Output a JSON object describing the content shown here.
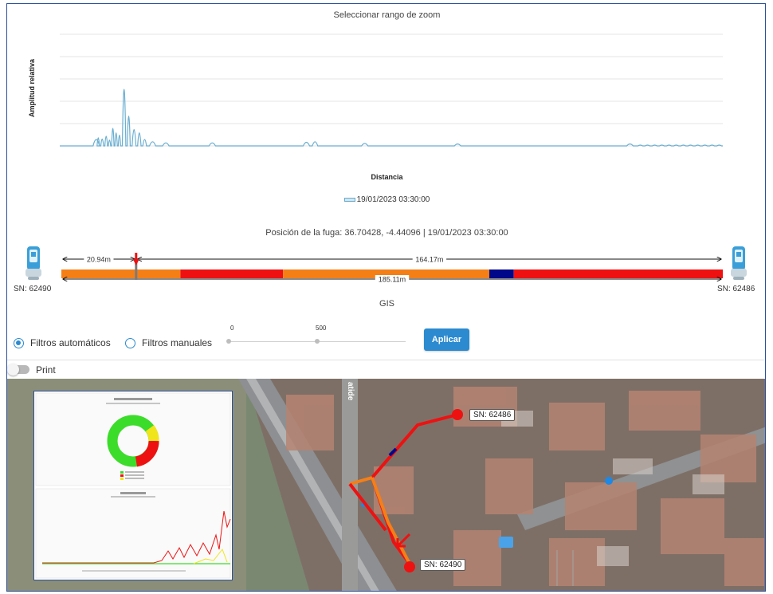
{
  "chart": {
    "title": "Seleccionar rango de zoom",
    "ylabel": "Amplitud relativa",
    "xlabel": "Distancia",
    "legend_label": "19/01/2023 03:30:00"
  },
  "chart_data": {
    "type": "line",
    "title": "Seleccionar rango de zoom",
    "xlabel": "Distancia",
    "ylabel": "Amplitud relativa",
    "grid": true,
    "ylim": [
      0,
      1
    ],
    "series": [
      {
        "name": "19/01/2023 03:30:00",
        "color": "#6aaed0",
        "peaks": [
          {
            "x": 0.055,
            "y": 0.1
          },
          {
            "x": 0.058,
            "y": 0.13
          },
          {
            "x": 0.064,
            "y": 0.11
          },
          {
            "x": 0.07,
            "y": 0.16
          },
          {
            "x": 0.075,
            "y": 0.09
          },
          {
            "x": 0.08,
            "y": 0.3
          },
          {
            "x": 0.085,
            "y": 0.22
          },
          {
            "x": 0.09,
            "y": 0.18
          },
          {
            "x": 0.097,
            "y": 1.0
          },
          {
            "x": 0.104,
            "y": 0.52
          },
          {
            "x": 0.112,
            "y": 0.28
          },
          {
            "x": 0.12,
            "y": 0.22
          },
          {
            "x": 0.128,
            "y": 0.1
          },
          {
            "x": 0.14,
            "y": 0.06
          },
          {
            "x": 0.16,
            "y": 0.04
          },
          {
            "x": 0.23,
            "y": 0.04
          },
          {
            "x": 0.372,
            "y": 0.05
          },
          {
            "x": 0.385,
            "y": 0.06
          },
          {
            "x": 0.46,
            "y": 0.03
          },
          {
            "x": 0.6,
            "y": 0.02
          },
          {
            "x": 0.86,
            "y": 0.02
          }
        ]
      }
    ]
  },
  "leak": {
    "position_text": "Posición de la fuga: 36.70428, -4.44096  |  19/01/2023 03:30:00",
    "left_distance": "20.94m",
    "right_distance": "164.17m",
    "total_distance": "185.11m",
    "gis_label": "GIS",
    "left_sensor": "SN: 62490",
    "right_sensor": "SN: 62486",
    "marker_fraction": 0.113
  },
  "pipe_segments": [
    {
      "from": 0.0,
      "to": 0.18,
      "color": "#f57f17"
    },
    {
      "from": 0.18,
      "to": 0.335,
      "color": "#ee1111"
    },
    {
      "from": 0.335,
      "to": 0.647,
      "color": "#f57f17"
    },
    {
      "from": 0.647,
      "to": 0.684,
      "color": "#00088a"
    },
    {
      "from": 0.684,
      "to": 1.0,
      "color": "#ee1111"
    }
  ],
  "filters": {
    "automatic_label": "Filtros automáticos",
    "manual_label": "Filtros manuales",
    "automatic_selected": true,
    "slider_min_label": "0",
    "slider_max_label": "500",
    "apply_label": "Aplicar"
  },
  "print": {
    "label": "Print",
    "enabled": false
  },
  "map": {
    "street_label": "atide",
    "tag_top": "SN: 62486",
    "tag_bottom": "SN: 62490"
  },
  "colors": {
    "accent": "#2b8ad0",
    "pipe_orange": "#f57f17",
    "pipe_red": "#ee1111",
    "pipe_blue": "#00088a"
  }
}
